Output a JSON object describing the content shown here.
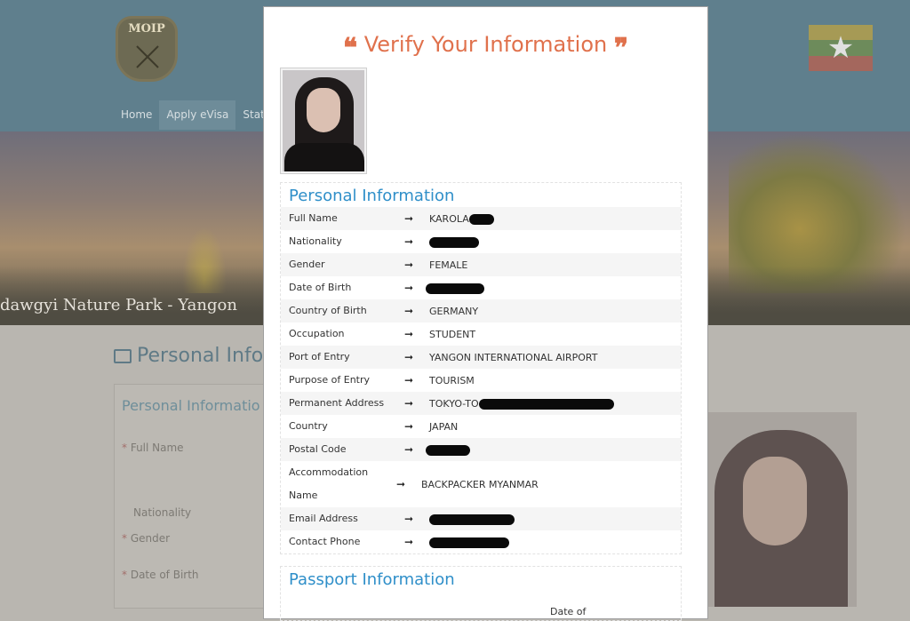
{
  "background": {
    "logo_text": "MOIP",
    "nav": [
      "Home",
      "Apply eVisa",
      "Status"
    ],
    "banner_caption": "dawgyi Nature Park - Yangon",
    "page_title": "Personal Info",
    "panel_title": "Personal Informatio",
    "form_labels": {
      "full_name": "Full Name",
      "nationality": "Nationality",
      "gender": "Gender",
      "dob": "Date of Birth"
    },
    "required_mark": "*"
  },
  "modal": {
    "title": "Verify Your Information",
    "quote_open": "❝",
    "quote_close": "❞",
    "personal": {
      "title": "Personal Information",
      "arrow": "➞",
      "rows": [
        {
          "label": "Full Name",
          "value": "KAROLA",
          "redacted": true
        },
        {
          "label": "Nationality",
          "value": "",
          "redacted": true
        },
        {
          "label": "Gender",
          "value": "FEMALE"
        },
        {
          "label": "Date of Birth",
          "value": "",
          "redacted": true
        },
        {
          "label": "Country of Birth",
          "value": "GERMANY"
        },
        {
          "label": "Occupation",
          "value": "STUDENT"
        },
        {
          "label": "Port of Entry",
          "value": "YANGON INTERNATIONAL AIRPORT"
        },
        {
          "label": "Purpose of Entry",
          "value": "TOURISM"
        },
        {
          "label": "Permanent Address",
          "value": "TOKYO-TO",
          "redacted": true
        },
        {
          "label": "Country",
          "value": "JAPAN"
        },
        {
          "label": "Postal Code",
          "value": "",
          "redacted": true
        },
        {
          "label": "Accommodation Name",
          "value": "BACKPACKER MYANMAR"
        },
        {
          "label": "Email Address",
          "value": "",
          "redacted": true
        },
        {
          "label": "Contact Phone",
          "value": "",
          "redacted": true
        }
      ]
    },
    "passport": {
      "title": "Passport Information",
      "partial_label": "Date of"
    }
  }
}
